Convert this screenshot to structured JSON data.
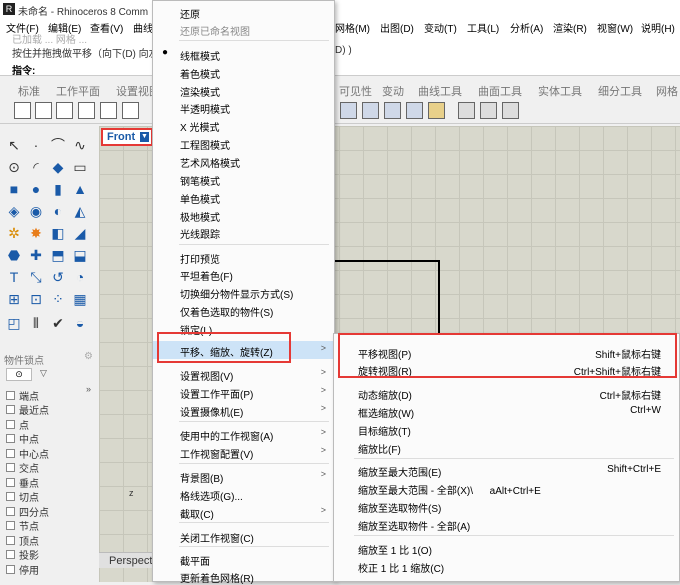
{
  "window": {
    "title": "未命名 - Rhinoceros 8 Comm"
  },
  "menubar": {
    "items": [
      "文件(F)",
      "编辑(E)",
      "查看(V)",
      "曲线",
      "网格(M)",
      "出图(D)",
      "变动(T)",
      "工具(L)",
      "分析(A)",
      "渲染(R)",
      "视窗(W)",
      "说明(H)"
    ]
  },
  "command": {
    "line1": "已加载 ... 网格 ...",
    "line2_a": "按住并拖拽做平移（向下(D) 向左",
    "line2_b": "D) )",
    "prompt": "指令:"
  },
  "toolbar_tabs": [
    "标准",
    "工作平面",
    "设置视图",
    "可见性",
    "变动",
    "曲线工具",
    "曲面工具",
    "实体工具",
    "细分工具",
    "网格"
  ],
  "viewport": {
    "name": "Front",
    "bottom_label": "Perspect"
  },
  "osnap_panel": {
    "title": "物件锁点",
    "items": [
      "端点",
      "最近点",
      "点",
      "中点",
      "中心点",
      "交点",
      "垂点",
      "切点",
      "四分点",
      "节点",
      "顶点",
      "投影",
      "停用"
    ]
  },
  "view_menu": {
    "items": [
      {
        "label": "还原",
        "disabled": false,
        "arrow": false
      },
      {
        "label": "还原已命名视图",
        "disabled": true,
        "arrow": false
      },
      {
        "label": "线框模式",
        "disabled": false,
        "arrow": false,
        "checked": true
      },
      {
        "label": "着色模式",
        "disabled": false,
        "arrow": false
      },
      {
        "label": "渲染模式",
        "disabled": false,
        "arrow": false
      },
      {
        "label": "半透明模式",
        "disabled": false,
        "arrow": false
      },
      {
        "label": "X 光模式",
        "disabled": false,
        "arrow": false
      },
      {
        "label": "工程图模式",
        "disabled": false,
        "arrow": false
      },
      {
        "label": "艺术风格模式",
        "disabled": false,
        "arrow": false
      },
      {
        "label": "钢笔模式",
        "disabled": false,
        "arrow": false
      },
      {
        "label": "单色模式",
        "disabled": false,
        "arrow": false
      },
      {
        "label": "极地模式",
        "disabled": false,
        "arrow": false
      },
      {
        "label": "光线跟踪",
        "disabled": false,
        "arrow": false
      },
      {
        "label": "打印预览",
        "disabled": false,
        "arrow": false
      },
      {
        "label": "平坦着色(F)",
        "disabled": false,
        "arrow": false
      },
      {
        "label": "切换细分物件显示方式(S)",
        "disabled": false,
        "arrow": false
      },
      {
        "label": "仅着色选取的物件(S)",
        "disabled": false,
        "arrow": false
      },
      {
        "label": "锁定(L)",
        "disabled": false,
        "arrow": false
      },
      {
        "label": "平移、缩放、旋转(Z)",
        "disabled": false,
        "arrow": true,
        "highlighted": true
      },
      {
        "label": "设置视图(V)",
        "disabled": false,
        "arrow": true
      },
      {
        "label": "设置工作平面(P)",
        "disabled": false,
        "arrow": true
      },
      {
        "label": "设置摄像机(E)",
        "disabled": false,
        "arrow": true
      },
      {
        "label": "使用中的工作视窗(A)",
        "disabled": false,
        "arrow": true
      },
      {
        "label": "工作视窗配置(V)",
        "disabled": false,
        "arrow": true
      },
      {
        "label": "背景图(B)",
        "disabled": false,
        "arrow": true
      },
      {
        "label": "格线选项(G)...",
        "disabled": false,
        "arrow": false
      },
      {
        "label": "截取(C)",
        "disabled": false,
        "arrow": true
      },
      {
        "label": "关闭工作视窗(C)",
        "disabled": false,
        "arrow": false
      },
      {
        "label": "截平面",
        "disabled": false,
        "arrow": false
      },
      {
        "label": "更新着色网格(R)",
        "disabled": false,
        "arrow": false
      }
    ]
  },
  "submenu": {
    "items": [
      {
        "label": "平移视图(P)",
        "shortcut": "Shift+鼠标右键"
      },
      {
        "label": "旋转视图(R)",
        "shortcut": "Ctrl+Shift+鼠标右键"
      },
      {
        "label": "动态缩放(D)",
        "shortcut": "Ctrl+鼠标右键"
      },
      {
        "label": "框选缩放(W)",
        "shortcut": "Ctrl+W"
      },
      {
        "label": "目标缩放(T)",
        "shortcut": ""
      },
      {
        "label": "缩放比(F)",
        "shortcut": ""
      },
      {
        "label": "缩放至最大范围(E)",
        "shortcut": "Shift+Ctrl+E"
      },
      {
        "label": "缩放至最大范围 - 全部(X)\\      aAlt+Ctrl+E",
        "shortcut": ""
      },
      {
        "label": "缩放至选取物件(S)",
        "shortcut": ""
      },
      {
        "label": "缩放至选取物件 - 全部(A)",
        "shortcut": ""
      },
      {
        "label": "缩放至 1 比 1(O)",
        "shortcut": ""
      },
      {
        "label": "校正 1 比 1 缩放(C)",
        "shortcut": ""
      }
    ]
  },
  "colors": {
    "highlight_box": "#e53935",
    "accent": "#1a5aa8"
  }
}
